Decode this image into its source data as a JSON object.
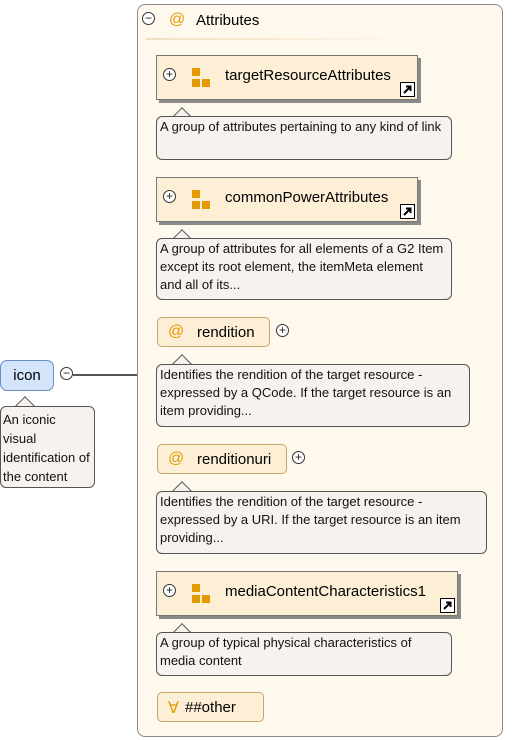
{
  "element": {
    "name": "icon",
    "description": "An iconic visual identification of the content"
  },
  "attributes_group": {
    "title": "Attributes",
    "at_symbol": "@",
    "collapse_symbol": "−",
    "expand_symbol": "+",
    "items": [
      {
        "kind": "group",
        "name": "targetResourceAttributes",
        "description": "A group of attributes pertaining to any kind of link"
      },
      {
        "kind": "group",
        "name": "commonPowerAttributes",
        "description": "A group of attributes for all elements of a G2 Item except its root element, the itemMeta element and all of its..."
      },
      {
        "kind": "attribute",
        "name": "rendition",
        "description": "Identifies the rendition of the target resource - expressed by a QCode. If the target resource is an item providing..."
      },
      {
        "kind": "attribute",
        "name": "renditionuri",
        "description": "Identifies the rendition of the target resource - expressed by a URI. If the target resource is an item providing..."
      },
      {
        "kind": "group",
        "name": "mediaContentCharacteristics1",
        "description": "A group of typical physical characteristics of media content"
      },
      {
        "kind": "wildcard",
        "name": "##other",
        "symbol": "∀"
      }
    ]
  },
  "colors": {
    "container_bg": "#fff8ec",
    "box_bg": "#fdefd6",
    "accent": "#e49a00",
    "element_bg": "#d4e5fb",
    "desc_bg": "#f6f3ee"
  }
}
